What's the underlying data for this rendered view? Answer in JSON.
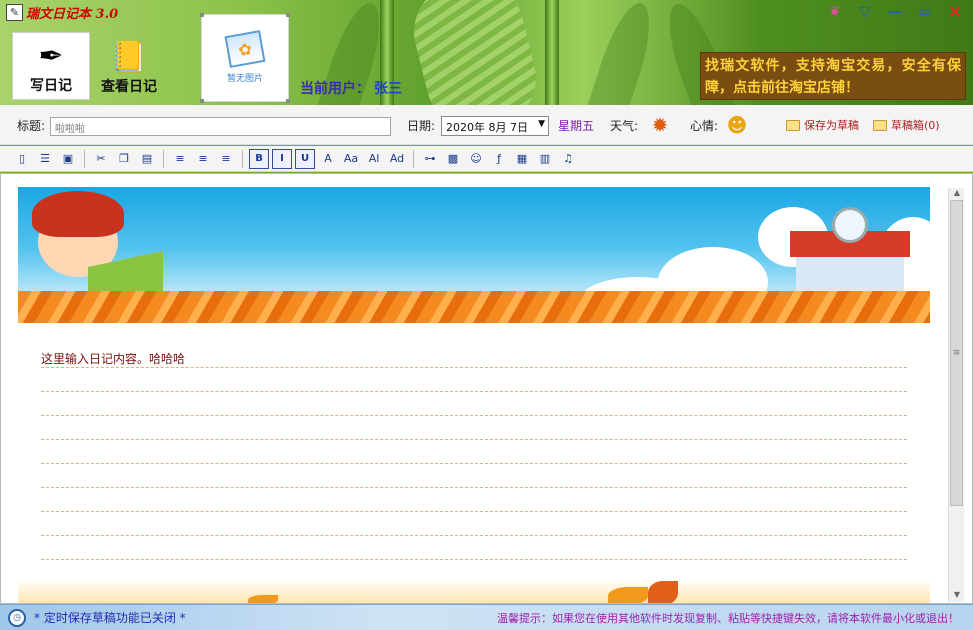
{
  "window": {
    "title": "瑞文日记本 3.0",
    "controls": {
      "skin": "❦",
      "menu": "▽",
      "minimize": "—",
      "maximize": "▭",
      "close": "✕"
    }
  },
  "nav": {
    "write_label": "写日记",
    "view_label": "查看日记"
  },
  "photo": {
    "label": "暂无图片"
  },
  "user": {
    "prefix": "当前用户：",
    "name": "张三"
  },
  "promo": {
    "text": "找瑞文软件，支持淘宝交易，安全有保障，点击前往淘宝店铺！"
  },
  "form": {
    "title_label": "标题:",
    "title_value": "啦啦啦",
    "date_label": "日期:",
    "date_value": "2020年 8月 7日",
    "weekday": "星期五",
    "weather_label": "天气:",
    "mood_label": "心情:",
    "save_draft": "保存为草稿",
    "draft_box": "草稿箱(0)"
  },
  "toolbar": [
    {
      "name": "new-doc-icon",
      "glyph": "▯"
    },
    {
      "name": "list-icon",
      "glyph": "☰"
    },
    {
      "name": "save-icon",
      "glyph": "▣"
    },
    {
      "sep": true
    },
    {
      "name": "cut-icon",
      "glyph": "✂"
    },
    {
      "name": "copy-icon",
      "glyph": "❐"
    },
    {
      "name": "paste-icon",
      "glyph": "▤"
    },
    {
      "sep": true
    },
    {
      "name": "align-left-icon",
      "glyph": "≡"
    },
    {
      "name": "align-center-icon",
      "glyph": "≡"
    },
    {
      "name": "align-right-icon",
      "glyph": "≡"
    },
    {
      "sep": true
    },
    {
      "name": "bold-icon",
      "glyph": "B",
      "boxed": true
    },
    {
      "name": "italic-icon",
      "glyph": "I",
      "boxed": true
    },
    {
      "name": "underline-icon",
      "glyph": "U",
      "boxed": true
    },
    {
      "name": "font-color-icon",
      "glyph": "A"
    },
    {
      "name": "font-bg-icon",
      "glyph": "Aa"
    },
    {
      "name": "font-size-icon",
      "glyph": "Al"
    },
    {
      "name": "font-style-icon",
      "glyph": "Ad"
    },
    {
      "sep": true
    },
    {
      "name": "link-icon",
      "glyph": "⊶"
    },
    {
      "name": "image-icon",
      "glyph": "▩"
    },
    {
      "name": "emoji-icon",
      "glyph": "☺"
    },
    {
      "name": "flash-icon",
      "glyph": "ƒ"
    },
    {
      "name": "table-icon",
      "glyph": "▦"
    },
    {
      "name": "grid-icon",
      "glyph": "▥"
    },
    {
      "name": "music-icon",
      "glyph": "♫"
    }
  ],
  "editor": {
    "content": "这里输入日记内容。哈哈哈"
  },
  "status": {
    "left": "* 定时保存草稿功能已关闭 *",
    "right": "温馨提示：如果您在使用其他软件时发现复制、粘贴等快捷键失效，请将本软件最小化或退出！"
  }
}
